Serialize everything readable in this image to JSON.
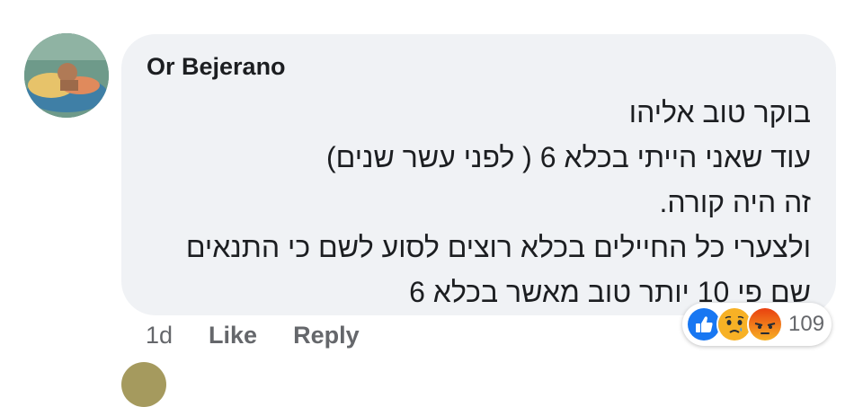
{
  "comment": {
    "author": "Or Bejerano",
    "lines": [
      "בוקר טוב אליהו",
      "עוד שאני הייתי בכלא 6 ( לפני עשר שנים)",
      "זה היה קורה.",
      "ולצערי כל החיילים בכלא רוצים לסוע לשם כי התנאים",
      "שם פי 10 יותר טוב מאשר בכלא 6"
    ]
  },
  "actions": {
    "time": "1d",
    "like_label": "Like",
    "reply_label": "Reply"
  },
  "reactions": {
    "icons": [
      "like-icon",
      "sad-icon",
      "angry-icon"
    ],
    "count": "109"
  },
  "colors": {
    "bubble": "#f0f2f5",
    "text": "#1c1e21",
    "secondary": "#65676b",
    "like_blue": "#1877f2",
    "sad_yellow": "#f7b125",
    "angry_red": "#e9710f"
  }
}
